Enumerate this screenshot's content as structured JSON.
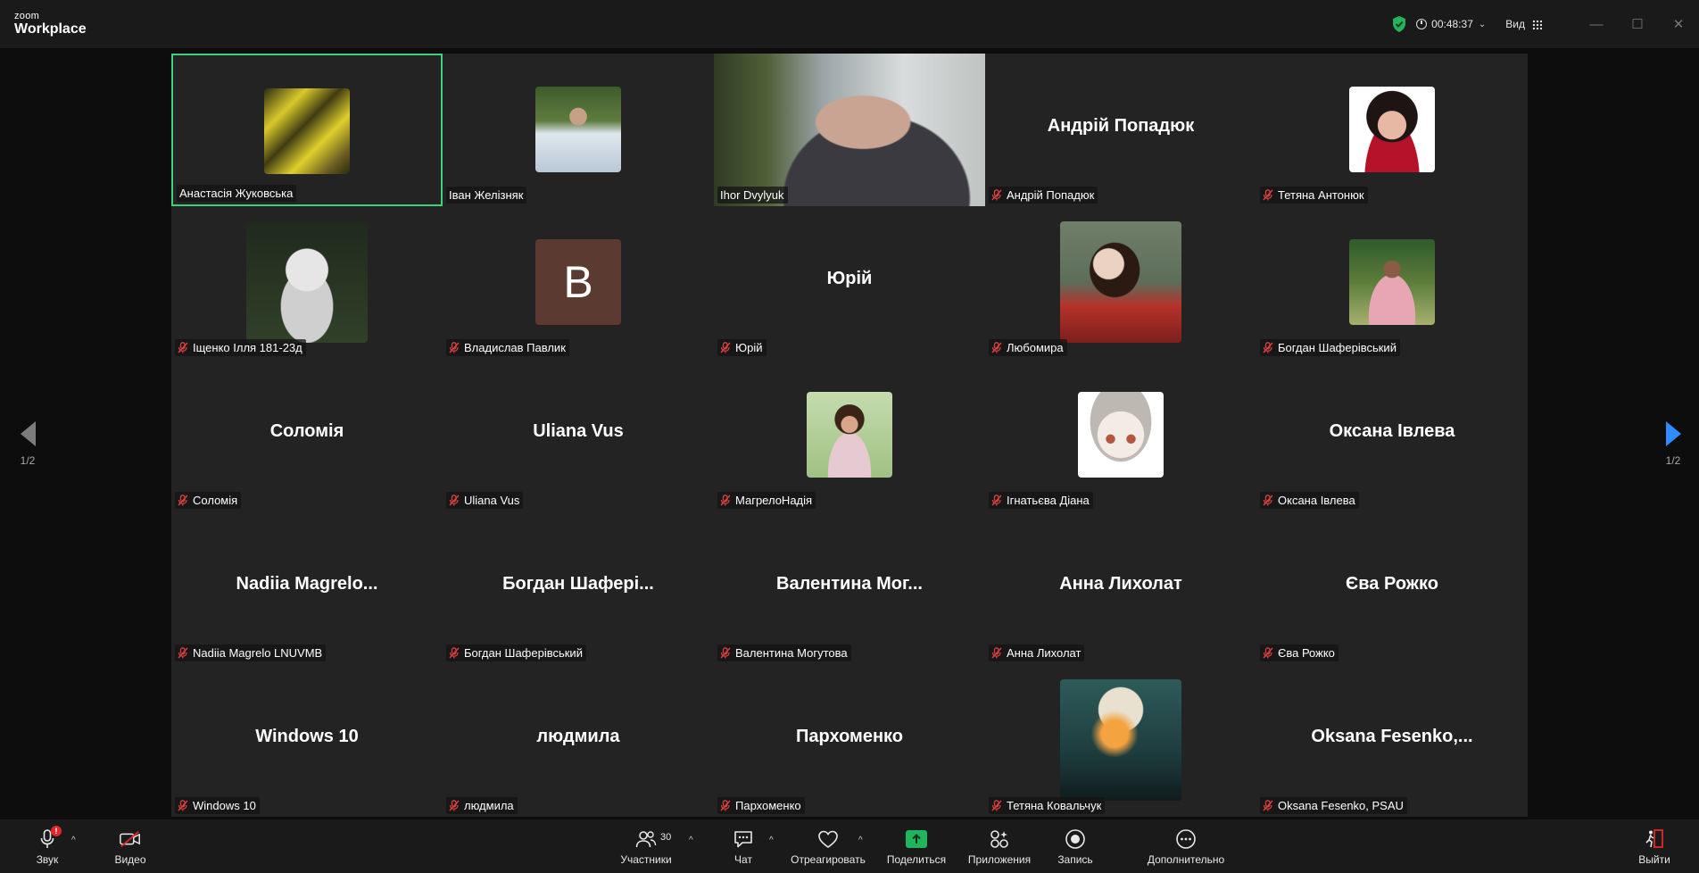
{
  "app": {
    "logo_small": "zoom",
    "logo_big": "Workplace"
  },
  "header": {
    "timer": "00:48:37",
    "view_label": "Вид",
    "minimize": "—",
    "maximize": "☐",
    "close": "✕",
    "accent_green": "#3ed17d"
  },
  "participants": [
    {
      "label": "Анастасія Жуковська",
      "display": "",
      "avatar": "photo-girl-letters",
      "muted": false,
      "active": true
    },
    {
      "label": "Іван Желізняк",
      "display": "",
      "avatar": "photo-man-shirt",
      "muted": false,
      "active": false
    },
    {
      "label": "Ihor Dvylyuk",
      "display": "",
      "avatar": "video-feed",
      "muted": false,
      "active": false
    },
    {
      "label": "Андрій Попадюк",
      "display": "Андрій Попадюк",
      "avatar": "",
      "muted": true,
      "active": false
    },
    {
      "label": "Тетяна Антонюк",
      "display": "",
      "avatar": "photo-woman-portrait",
      "muted": true,
      "active": false
    },
    {
      "label": "Іщенко Ілля 181-23д",
      "display": "",
      "avatar": "photo-statue",
      "muted": true,
      "active": false
    },
    {
      "label": "Владислав Павлик",
      "display": "",
      "avatar": "initial",
      "initial": "B",
      "muted": true,
      "active": false
    },
    {
      "label": "Юрій",
      "display": "Юрій",
      "avatar": "",
      "muted": true,
      "active": false
    },
    {
      "label": "Любомира",
      "display": "",
      "avatar": "photo-girl-plaid",
      "muted": true,
      "active": false
    },
    {
      "label": "Богдан Шаферівський",
      "display": "",
      "avatar": "photo-man-pink",
      "muted": true,
      "active": false
    },
    {
      "label": "Соломія",
      "display": "Соломія",
      "avatar": "",
      "muted": true,
      "active": false
    },
    {
      "label": "Uliana Vus",
      "display": "Uliana Vus",
      "avatar": "",
      "muted": true,
      "active": false
    },
    {
      "label": "МагрелоНадія",
      "display": "",
      "avatar": "photo-woman-green",
      "muted": true,
      "active": false
    },
    {
      "label": "Ігнатьєва Діана",
      "display": "",
      "avatar": "photo-anime",
      "muted": true,
      "active": false
    },
    {
      "label": "Оксана Івлева",
      "display": "Оксана Івлева",
      "avatar": "",
      "muted": true,
      "active": false
    },
    {
      "label": "Nadiia Magrelo LNUVMB",
      "display": "Nadiia  Magrelo...",
      "avatar": "",
      "muted": true,
      "active": false
    },
    {
      "label": "Богдан Шаферівський",
      "display": "Богдан  Шафері...",
      "avatar": "",
      "muted": true,
      "active": false
    },
    {
      "label": "Валентина Могутова",
      "display": "Валентина  Мог...",
      "avatar": "",
      "muted": true,
      "active": false
    },
    {
      "label": "Анна Лихолат",
      "display": "Анна Лихолат",
      "avatar": "",
      "muted": true,
      "active": false
    },
    {
      "label": "Єва Рожко",
      "display": "Єва Рожко",
      "avatar": "",
      "muted": true,
      "active": false
    },
    {
      "label": "Windows 10",
      "display": "Windows 10",
      "avatar": "",
      "muted": true,
      "active": false
    },
    {
      "label": "людмила",
      "display": "людмила",
      "avatar": "",
      "muted": true,
      "active": false
    },
    {
      "label": "Пархоменко",
      "display": "Пархоменко",
      "avatar": "",
      "muted": true,
      "active": false
    },
    {
      "label": "Тетяна Ковальчук",
      "display": "",
      "avatar": "photo-orange-light",
      "muted": true,
      "active": false
    },
    {
      "label": "Oksana Fesenko, PSAU",
      "display": "Oksana  Fesenko,...",
      "avatar": "",
      "muted": true,
      "active": false
    }
  ],
  "pagination": {
    "left": "1/2",
    "right": "1/2"
  },
  "toolbar": {
    "audio": "Звук",
    "audio_alert": "!",
    "video": "Видео",
    "participants": "Участники",
    "participants_count": "30",
    "chat": "Чат",
    "react": "Отреагировать",
    "share": "Поделиться",
    "apps": "Приложения",
    "record": "Запись",
    "more": "Дополнительно",
    "leave": "Выйти",
    "caret": "^",
    "leave_color": "#e02828",
    "share_color": "#1fb55c"
  }
}
